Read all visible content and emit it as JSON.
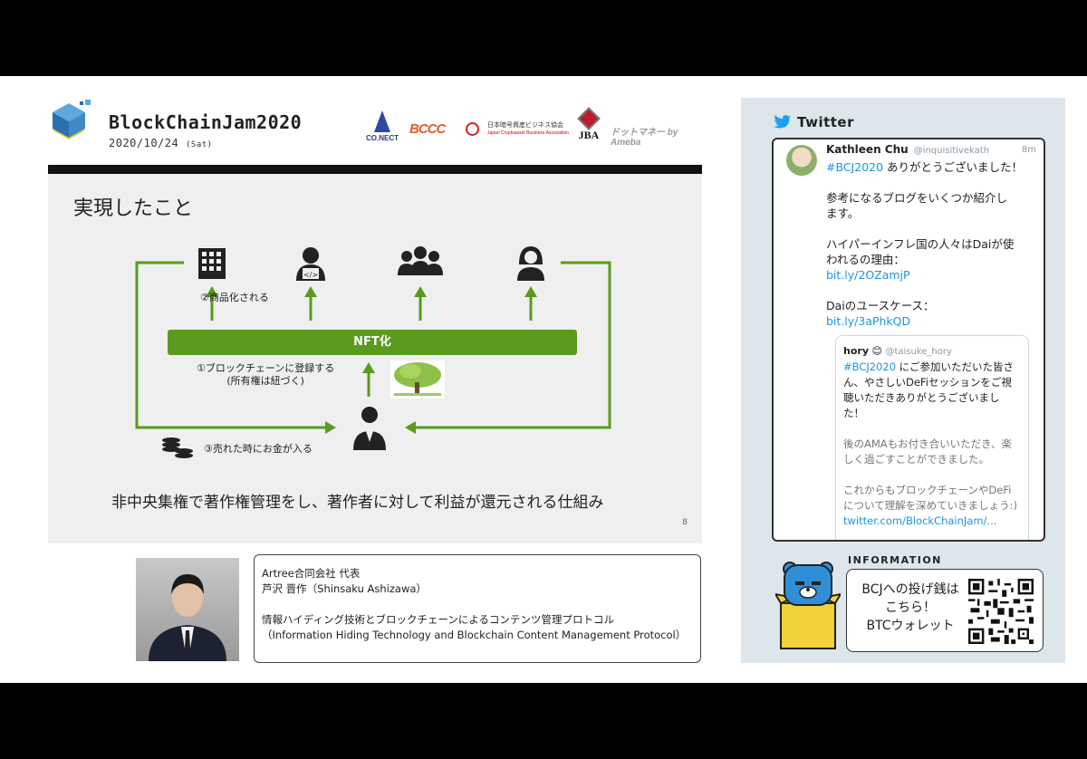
{
  "event": {
    "title": "BlockChainJam2020",
    "date": "2020/10/24",
    "date_suffix": "(Sat)"
  },
  "sponsors": {
    "connect": "CO.NECT",
    "bccc": "BCCC",
    "jcba": "日本暗号資産ビジネス協会",
    "jcba_en": "Japan Cryptoasset Business Association",
    "jba": "JBA",
    "dotmoney": "ドットマネー by Ameba"
  },
  "slide": {
    "title": "実現したこと",
    "nft_label": "NFT化",
    "step2": "②商品化される",
    "step1_line1": "①ブロックチェーンに登録する",
    "step1_line2": "(所有権は紐づく)",
    "step3": "③売れた時にお金が入る",
    "caption": "非中央集権で著作権管理をし、著作者に対して利益が還元される仕組み",
    "page": "8",
    "accent": "#5a9a1e"
  },
  "speaker": {
    "company": "Artree合同会社 代表",
    "name": "芦沢 晋作（Shinsaku Ashizawa）",
    "talk_title": "情報ハイディング技術とブロックチェーンによるコンテンツ管理プロトコル",
    "talk_title_en": "（Information Hiding Technology and Blockchain Content Management Protocol）"
  },
  "twitter": {
    "header": "Twitter",
    "tweet": {
      "author": "Kathleen Chu",
      "handle": "@inquisitivekath",
      "time": "8m",
      "hashtag": "#BCJ2020",
      "line1": " ありがとうございました！",
      "line2": "参考になるブログをいくつか紹介し",
      "line3": "ます。",
      "line4": "ハイパーインフレ国の人々はDaiが使",
      "line5": "われるの理由：",
      "link1": "bit.ly/2OZamjP",
      "line6": "Daiのユースケース：",
      "link2": "bit.ly/3aPhkQD"
    },
    "quote": {
      "author": "hory",
      "handle": "@taisuke_hory",
      "hashtag": "#BCJ2020",
      "line1": " にご参加いただいた皆さ",
      "line2": "ん、やさしいDeFiセッションをご視",
      "line3": "聴いただきありがとうございまし",
      "line4": "た！",
      "line5": "後のAMAもお付き合いいただき、楽",
      "line6": "しく過ごすことができました。",
      "line7": "これからもブロックチェーンやDeFi",
      "line8": "について理解を深めていきましょう:)",
      "link": "twitter.com/BlockChainJam/..."
    }
  },
  "information": {
    "label": "INFORMATION",
    "line1": "BCJへの投げ銭は",
    "line2": "こちら！",
    "line3": "BTCウォレット"
  }
}
